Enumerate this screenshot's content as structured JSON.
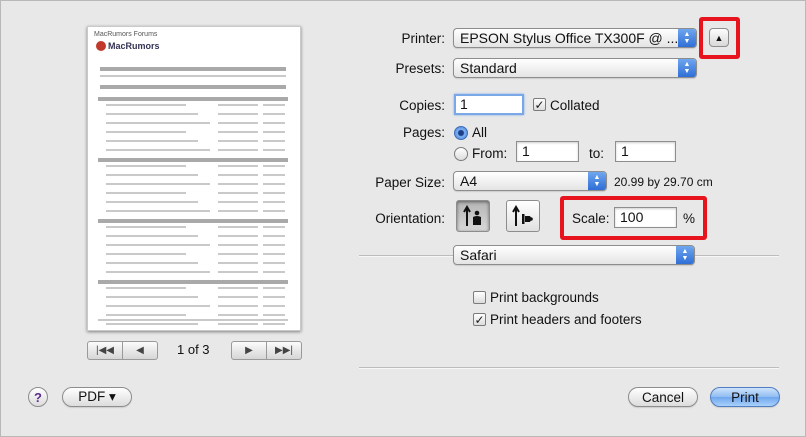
{
  "preview": {
    "page_indicator": "1 of 3",
    "site_name": "MacRumors"
  },
  "printer": {
    "label": "Printer:",
    "value": "EPSON Stylus Office TX300F @ ...",
    "disclosure_icon": "triangle-up-icon"
  },
  "presets": {
    "label": "Presets:",
    "value": "Standard"
  },
  "copies": {
    "label": "Copies:",
    "value": "1",
    "collated_label": "Collated",
    "collated_checked": true
  },
  "pages": {
    "label": "Pages:",
    "all_label": "All",
    "from_label": "From:",
    "from_value": "1",
    "to_label": "to:",
    "to_value": "1"
  },
  "paper_size": {
    "label": "Paper Size:",
    "value": "A4",
    "dimensions": "20.99 by 29.70 cm"
  },
  "orientation": {
    "label": "Orientation:",
    "selected": "portrait"
  },
  "scale": {
    "label": "Scale:",
    "value": "100",
    "unit": "%"
  },
  "app_section": {
    "value": "Safari"
  },
  "options": {
    "print_backgrounds": "Print backgrounds",
    "print_backgrounds_checked": false,
    "print_headers_footers": "Print headers and footers",
    "print_headers_footers_checked": true
  },
  "footer": {
    "help": "?",
    "pdf": "PDF ▾",
    "cancel": "Cancel",
    "print": "Print"
  },
  "colors": {
    "highlight": "#e8141d",
    "accent": "#3f7fdc"
  }
}
